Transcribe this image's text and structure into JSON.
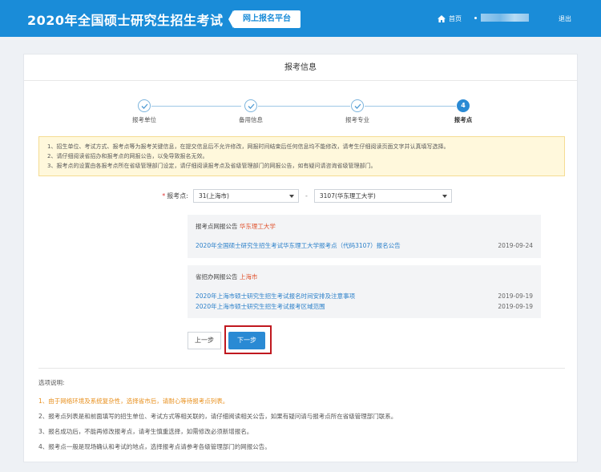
{
  "header": {
    "site_title": "2020年全国硕士研究生招生考试",
    "platform_badge": "网上报名平台",
    "home_label": "首页",
    "logout_label": "退出"
  },
  "card": {
    "title": "报考信息"
  },
  "steps": [
    {
      "label": "报考单位",
      "state": "done"
    },
    {
      "label": "备用信息",
      "state": "done"
    },
    {
      "label": "报考专业",
      "state": "done"
    },
    {
      "label": "报考点",
      "state": "active",
      "number": "4"
    }
  ],
  "notice": [
    "1、招生单位、考试方式、报考点等为报考关键信息，在提交信息后不允许修改，网报时间结束后任何信息均不能修改，请考生仔细阅读页面文字并认真填写选择。",
    "2、请仔细阅读省招办和报考点的网报公告，以免导致报名无效。",
    "3、报考点的设置由各报考点所在省级管理部门设定，请仔细阅读报考点及省级管理部门的网报公告，如有疑问请咨询省级管理部门。"
  ],
  "form": {
    "label": "报考点:",
    "required_mark": "*",
    "province_select": "31(上海市)",
    "separator": "-",
    "site_select": "3107(华东理工大学)"
  },
  "site_panel": {
    "heading_prefix": "报考点网报公告",
    "heading_highlight": "华东理工大学",
    "rows": [
      {
        "title": "2020年全国硕士研究生招生考试华东理工大学报考点（代码3107）报名公告",
        "date": "2019-09-24"
      }
    ]
  },
  "province_panel": {
    "heading_prefix": "省招办网报公告",
    "heading_highlight": "上海市",
    "rows": [
      {
        "title": "2020年上海市硕士研究生招生考试报名时间安排及注意事项",
        "date": "2019-09-19"
      },
      {
        "title": "2020年上海市硕士研究生招生考试报考区域范围",
        "date": "2019-09-19"
      }
    ]
  },
  "buttons": {
    "prev": "上一步",
    "next": "下一步"
  },
  "notes": {
    "title": "选项说明:",
    "items": [
      "1、由于网络环境及系统复杂性，选择省市后，请耐心等待报考点列表。",
      "2、报考点列表是和前面填写的招生单位、考试方式等相关联的，请仔细阅读相关公告，如果有疑问请与报考点所在省级管理部门联系。",
      "3、报名成功后，不能再修改报考点，请考生慎重选择，如需修改必须新增报名。",
      "4、报考点一般是现场确认和考试的地点，选择报考点请参考各级管理部门的网报公告。"
    ]
  },
  "colors": {
    "header_bg": "#1a8cd8",
    "accent": "#2a8ad4",
    "highlight_red": "#e0522d",
    "warn_orange": "#e8901e",
    "annotation_box": "#c0181f"
  }
}
